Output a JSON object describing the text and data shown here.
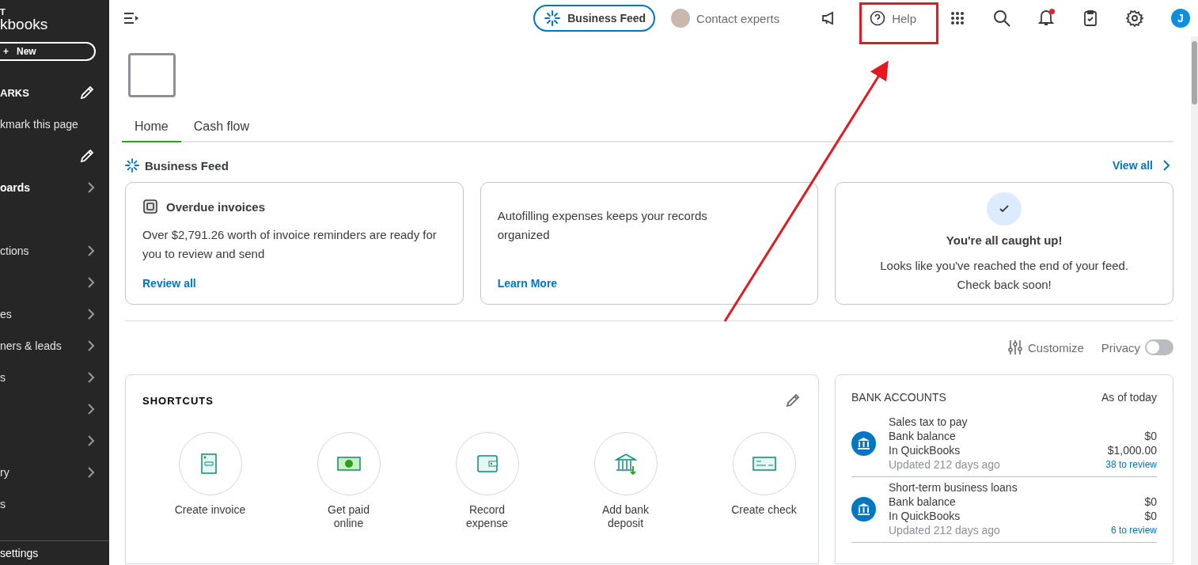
{
  "sidebar": {
    "logo": {
      "line_1": "T",
      "line_2": "kbooks"
    },
    "new_button": {
      "icon": "+",
      "label": "New"
    },
    "bookmarks": {
      "title": "ARKS",
      "items": [
        "kmark this page"
      ]
    },
    "nav": [
      {
        "label": "oards",
        "selected": true,
        "chevron": true
      },
      {
        "chevron": false
      },
      {
        "label": "ctions",
        "selected": false,
        "chevron": true
      },
      {
        "chevron": true
      },
      {
        "label": "es",
        "selected": false,
        "chevron": true
      },
      {
        "label": "ners & leads",
        "selected": false,
        "chevron": true
      },
      {
        "label": "s",
        "selected": false,
        "chevron": true
      },
      {
        "chevron": true
      },
      {
        "chevron": true
      },
      {
        "label": "ry",
        "selected": false,
        "chevron": true
      },
      {
        "label": "s",
        "selected": false,
        "chevron": false
      }
    ],
    "footer": "settings"
  },
  "top_bar": {
    "business_feed": "Business Feed",
    "contact_experts": "Contact experts",
    "help": "Help",
    "notification_dot": true,
    "avatar_initial": "J"
  },
  "tabs": [
    {
      "label": "Home",
      "selected": true
    },
    {
      "label": "Cash flow",
      "selected": false
    }
  ],
  "business_feed": {
    "title": "Business Feed",
    "view_all": "View all",
    "cards": [
      {
        "kind": "alert",
        "title": "Overdue invoices",
        "text": "Over $2,791.26 worth of invoice reminders are ready for you to review and send",
        "link": "Review all"
      },
      {
        "kind": "tip",
        "text": "Autofilling expenses keeps your records organized",
        "link": "Learn More"
      },
      {
        "kind": "done",
        "title": "You're all caught up!",
        "text": "Looks like you've reached the end of your feed. Check back soon!"
      }
    ]
  },
  "controls": {
    "customize": "Customize",
    "privacy": "Privacy",
    "privacy_on": false
  },
  "shortcuts": {
    "title": "SHORTCUTS",
    "items": [
      {
        "kind": "invoice",
        "label": "Create invoice"
      },
      {
        "kind": "paid",
        "label": "Get paid online"
      },
      {
        "kind": "expense",
        "label": "Record expense"
      },
      {
        "kind": "deposit",
        "label": "Add bank deposit"
      },
      {
        "kind": "check",
        "label": "Create check"
      }
    ]
  },
  "bank_accounts": {
    "title": "BANK ACCOUNTS",
    "as_of": "As of today",
    "accounts": [
      {
        "name": "Sales tax to pay",
        "bank_label": "Bank balance",
        "bank_value": "$0",
        "qb_label": "In QuickBooks",
        "qb_value": "$1,000.00",
        "updated": "Updated 212 days ago",
        "review": "38 to review"
      },
      {
        "name": "Short-term business loans",
        "bank_label": "Bank balance",
        "bank_value": "$0",
        "qb_label": "In QuickBooks",
        "qb_value": "$0",
        "updated": "Updated 212 days ago",
        "review": "6 to review"
      }
    ]
  }
}
